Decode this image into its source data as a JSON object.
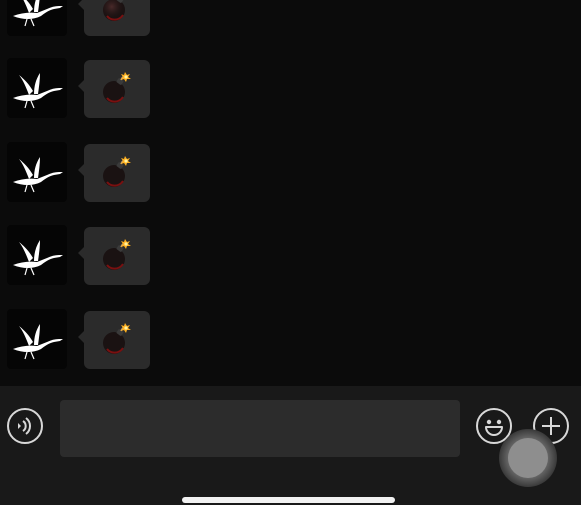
{
  "messages": [
    {
      "sender_icon": "crane-icon",
      "content_icon": "bomb-icon"
    },
    {
      "sender_icon": "crane-icon",
      "content_icon": "bomb-icon"
    },
    {
      "sender_icon": "crane-icon",
      "content_icon": "bomb-icon"
    },
    {
      "sender_icon": "crane-icon",
      "content_icon": "bomb-icon"
    },
    {
      "sender_icon": "crane-icon",
      "content_icon": "bomb-icon"
    }
  ],
  "input_bar": {
    "voice_icon": "voice-icon",
    "text_value": "",
    "placeholder": "",
    "emoji_icon": "emoji-icon",
    "plus_icon": "plus-icon"
  },
  "colors": {
    "chat_background": "#0b0b0b",
    "bubble": "#2b2b2b",
    "input_bar": "#191919",
    "input_field": "#2c2c2c",
    "icon_stroke": "#d8d8d8"
  }
}
